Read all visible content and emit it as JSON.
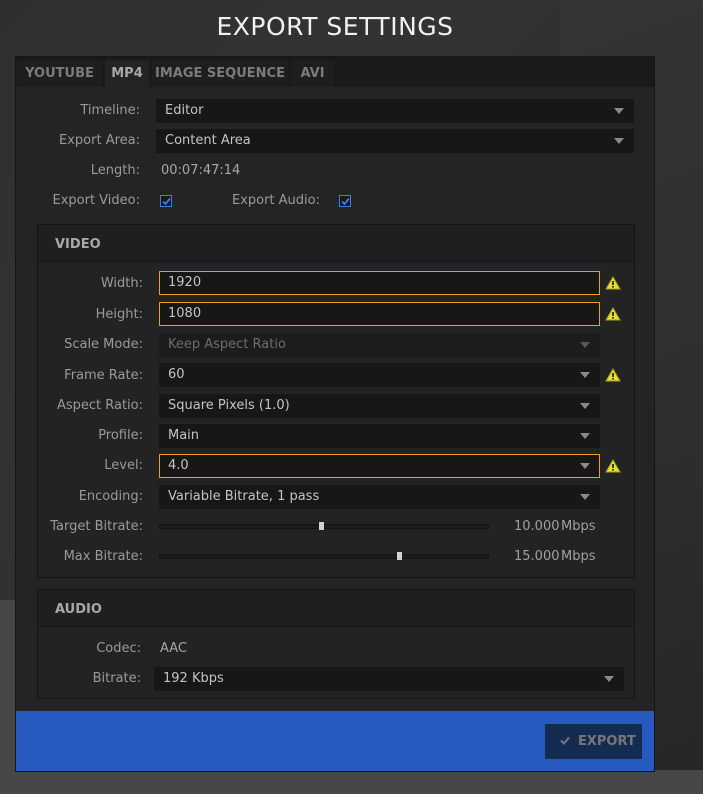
{
  "title": "EXPORT SETTINGS",
  "tabs": [
    {
      "label": "YOUTUBE",
      "active": false
    },
    {
      "label": "MP4",
      "active": true
    },
    {
      "label": "IMAGE SEQUENCE",
      "active": false
    },
    {
      "label": "AVI",
      "active": false
    }
  ],
  "general": {
    "timeline": {
      "label": "Timeline:",
      "value": "Editor"
    },
    "export_area": {
      "label": "Export Area:",
      "value": "Content Area"
    },
    "length": {
      "label": "Length:",
      "value": "00:07:47:14"
    },
    "export_video": {
      "label": "Export Video:",
      "checked": true
    },
    "export_audio": {
      "label": "Export Audio:",
      "checked": true
    }
  },
  "video": {
    "title": "VIDEO",
    "width": {
      "label": "Width:",
      "value": "1920",
      "warning": true
    },
    "height": {
      "label": "Height:",
      "value": "1080",
      "warning": true
    },
    "scale_mode": {
      "label": "Scale Mode:",
      "value": "Keep Aspect Ratio",
      "disabled": true
    },
    "frame_rate": {
      "label": "Frame Rate:",
      "value": "60",
      "warning": true
    },
    "aspect_ratio": {
      "label": "Aspect Ratio:",
      "value": "Square Pixels (1.0)"
    },
    "profile": {
      "label": "Profile:",
      "value": "Main"
    },
    "level": {
      "label": "Level:",
      "value": "4.0",
      "warning": true
    },
    "encoding": {
      "label": "Encoding:",
      "value": "Variable Bitrate, 1 pass"
    },
    "target_bitrate": {
      "label": "Target Bitrate:",
      "value": "10.000",
      "unit": "Mbps",
      "slider_fraction": 0.49
    },
    "max_bitrate": {
      "label": "Max Bitrate:",
      "value": "15.000",
      "unit": "Mbps",
      "slider_fraction": 0.73
    }
  },
  "audio": {
    "title": "AUDIO",
    "codec": {
      "label": "Codec:",
      "value": "AAC"
    },
    "bitrate": {
      "label": "Bitrate:",
      "value": "192 Kbps"
    }
  },
  "footer": {
    "export_label": "EXPORT"
  },
  "colors": {
    "accent_blue": "#275ac0",
    "warning_border": "#e6a120",
    "warning_icon": "#e8e030",
    "checkbox_blue": "#3b7de0"
  }
}
